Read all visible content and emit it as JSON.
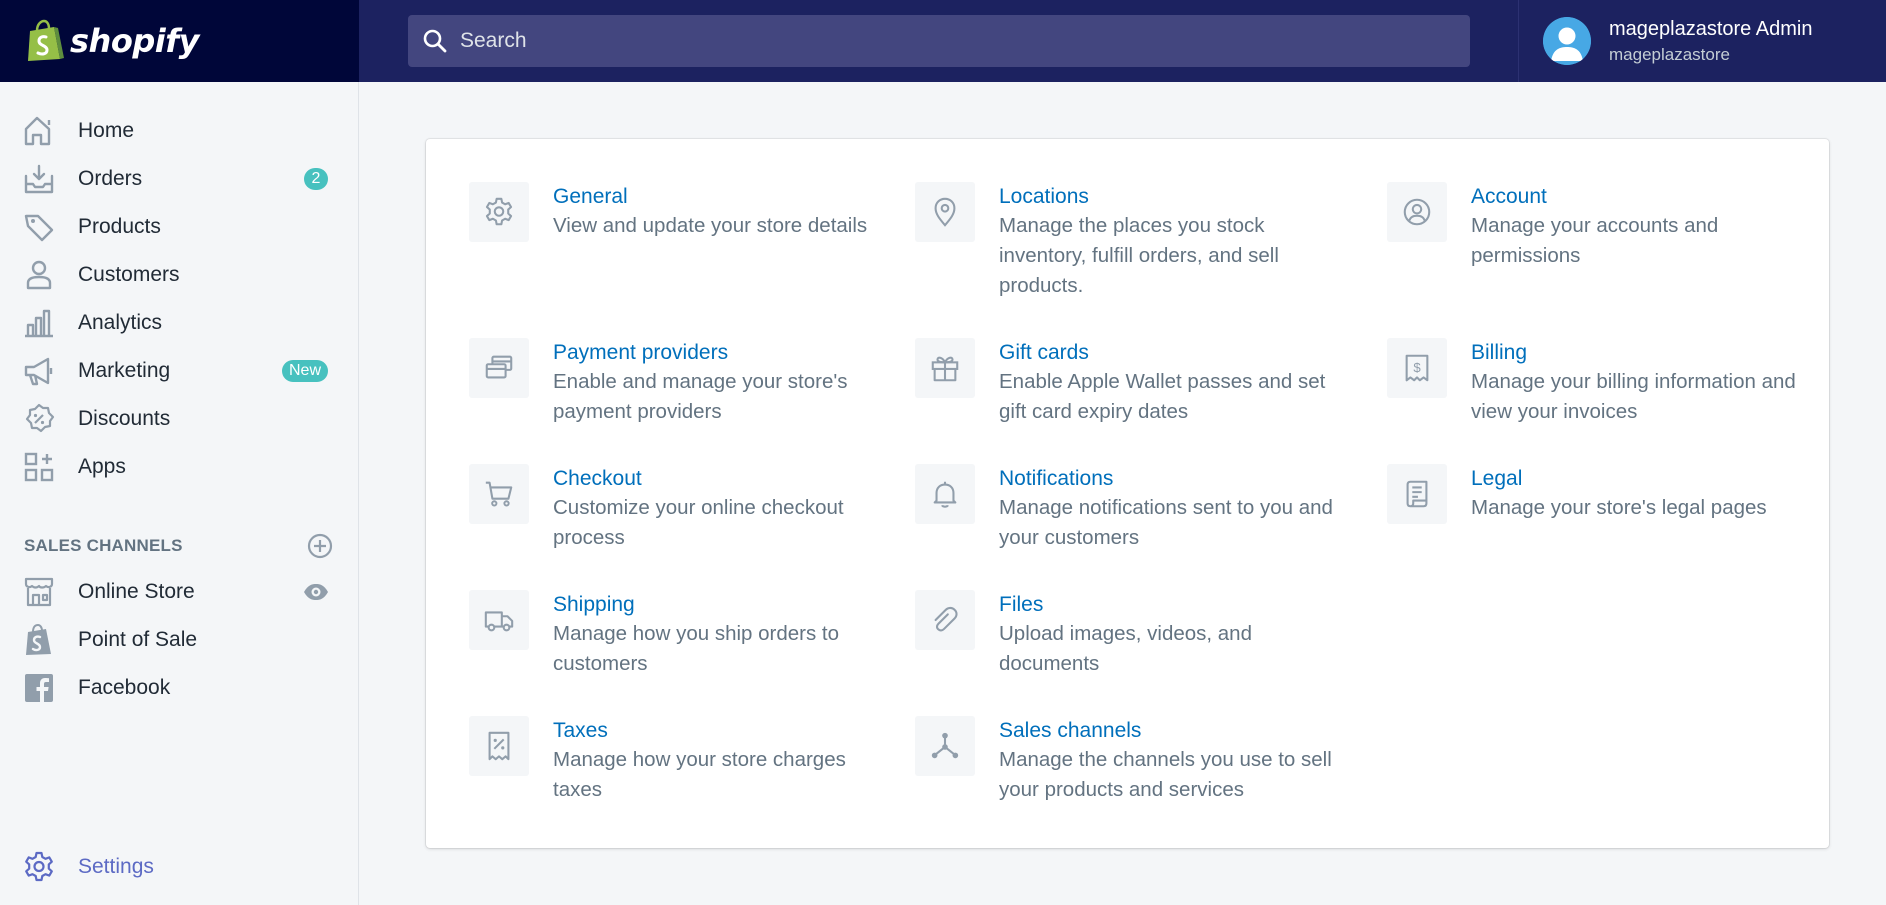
{
  "app": {
    "logo_text": "shopify"
  },
  "search": {
    "placeholder": "Search"
  },
  "user": {
    "name": "mageplazastore Admin",
    "store": "mageplazastore"
  },
  "nav": {
    "items": [
      {
        "label": "Home",
        "icon": "home-icon"
      },
      {
        "label": "Orders",
        "icon": "orders-icon",
        "badge": "2"
      },
      {
        "label": "Products",
        "icon": "tag-icon"
      },
      {
        "label": "Customers",
        "icon": "person-icon"
      },
      {
        "label": "Analytics",
        "icon": "bar-chart-icon"
      },
      {
        "label": "Marketing",
        "icon": "megaphone-icon",
        "badge": "New"
      },
      {
        "label": "Discounts",
        "icon": "discount-icon"
      },
      {
        "label": "Apps",
        "icon": "apps-icon"
      }
    ],
    "sales_channels_title": "SALES CHANNELS",
    "channels": [
      {
        "label": "Online Store",
        "icon": "store-icon"
      },
      {
        "label": "Point of Sale",
        "icon": "shopify-bag-icon"
      },
      {
        "label": "Facebook",
        "icon": "facebook-icon"
      }
    ],
    "settings_label": "Settings"
  },
  "settings": [
    {
      "title": "General",
      "description": "View and update your store details",
      "icon": "gear-icon"
    },
    {
      "title": "Locations",
      "description": "Manage the places you stock inventory, fulfill orders, and sell products.",
      "icon": "location-pin-icon"
    },
    {
      "title": "Account",
      "description": "Manage your accounts and permissions",
      "icon": "account-icon"
    },
    {
      "title": "Payment providers",
      "description": "Enable and manage your store's payment providers",
      "icon": "payment-icon"
    },
    {
      "title": "Gift cards",
      "description": "Enable Apple Wallet passes and set gift card expiry dates",
      "icon": "gift-icon"
    },
    {
      "title": "Billing",
      "description": "Manage your billing information and view your invoices",
      "icon": "billing-icon"
    },
    {
      "title": "Checkout",
      "description": "Customize your online checkout process",
      "icon": "cart-icon"
    },
    {
      "title": "Notifications",
      "description": "Manage notifications sent to you and your customers",
      "icon": "bell-icon"
    },
    {
      "title": "Legal",
      "description": "Manage your store's legal pages",
      "icon": "legal-icon"
    },
    {
      "title": "Shipping",
      "description": "Manage how you ship orders to customers",
      "icon": "truck-icon"
    },
    {
      "title": "Files",
      "description": "Upload images, videos, and documents",
      "icon": "paperclip-icon"
    },
    {
      "title": "Taxes",
      "description": "Manage how your store charges taxes",
      "icon": "tax-icon"
    },
    {
      "title": "Sales channels",
      "description": "Manage the channels you use to sell your products and services",
      "icon": "sales-channels-icon"
    }
  ],
  "colors": {
    "topbar": "#1c2260",
    "logo_bg": "#000639",
    "link": "#006fbb",
    "badge": "#47c1bf",
    "settings_active": "#5c6ac4"
  }
}
